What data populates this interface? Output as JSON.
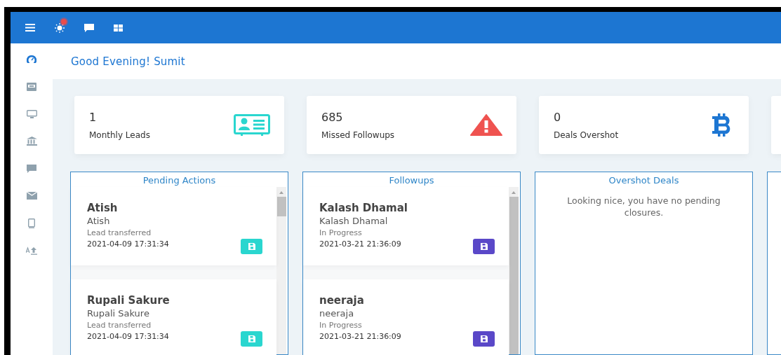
{
  "topbar": {
    "icons": [
      {
        "kind": "menu"
      },
      {
        "kind": "sun",
        "badge": true
      },
      {
        "kind": "chat"
      },
      {
        "kind": "grid"
      }
    ]
  },
  "sidebar": {
    "items": [
      {
        "kind": "gauge",
        "selected": true
      },
      {
        "kind": "idcard",
        "selected": false
      },
      {
        "kind": "monitor",
        "selected": false
      },
      {
        "kind": "bank",
        "selected": false
      },
      {
        "kind": "chat",
        "selected": false
      },
      {
        "kind": "mail",
        "selected": false
      },
      {
        "kind": "phone",
        "selected": false
      },
      {
        "kind": "textsize",
        "selected": false
      }
    ]
  },
  "greeting": "Good Evening! Sumit",
  "stats": [
    {
      "value": "1",
      "label": "Monthly Leads",
      "kind": "idcard"
    },
    {
      "value": "685",
      "label": "Missed Followups",
      "kind": "warning"
    },
    {
      "value": "0",
      "label": "Deals Overshot",
      "kind": "bitcoin"
    }
  ],
  "panels": [
    {
      "title": "Pending Actions",
      "color": "#2ad6cf",
      "items": [
        {
          "name": "Atish",
          "subname": "Atish",
          "status": "Lead transferred",
          "date": "2021-04-09 17:31:34"
        },
        {
          "name": "Rupali Sakure",
          "subname": "Rupali Sakure",
          "status": "Lead transferred",
          "date": "2021-04-09 17:31:34"
        }
      ]
    },
    {
      "title": "Followups",
      "color": "#5a48c8",
      "items": [
        {
          "name": "Kalash Dhamal",
          "subname": "Kalash Dhamal",
          "status": "In Progress",
          "date": "2021-03-21 21:36:09"
        },
        {
          "name": "neeraja",
          "subname": "neeraja",
          "status": "In Progress",
          "date": "2021-03-21 21:36:09"
        }
      ]
    },
    {
      "title": "Overshot Deals",
      "message": "Looking nice, you have no pending closures."
    }
  ]
}
